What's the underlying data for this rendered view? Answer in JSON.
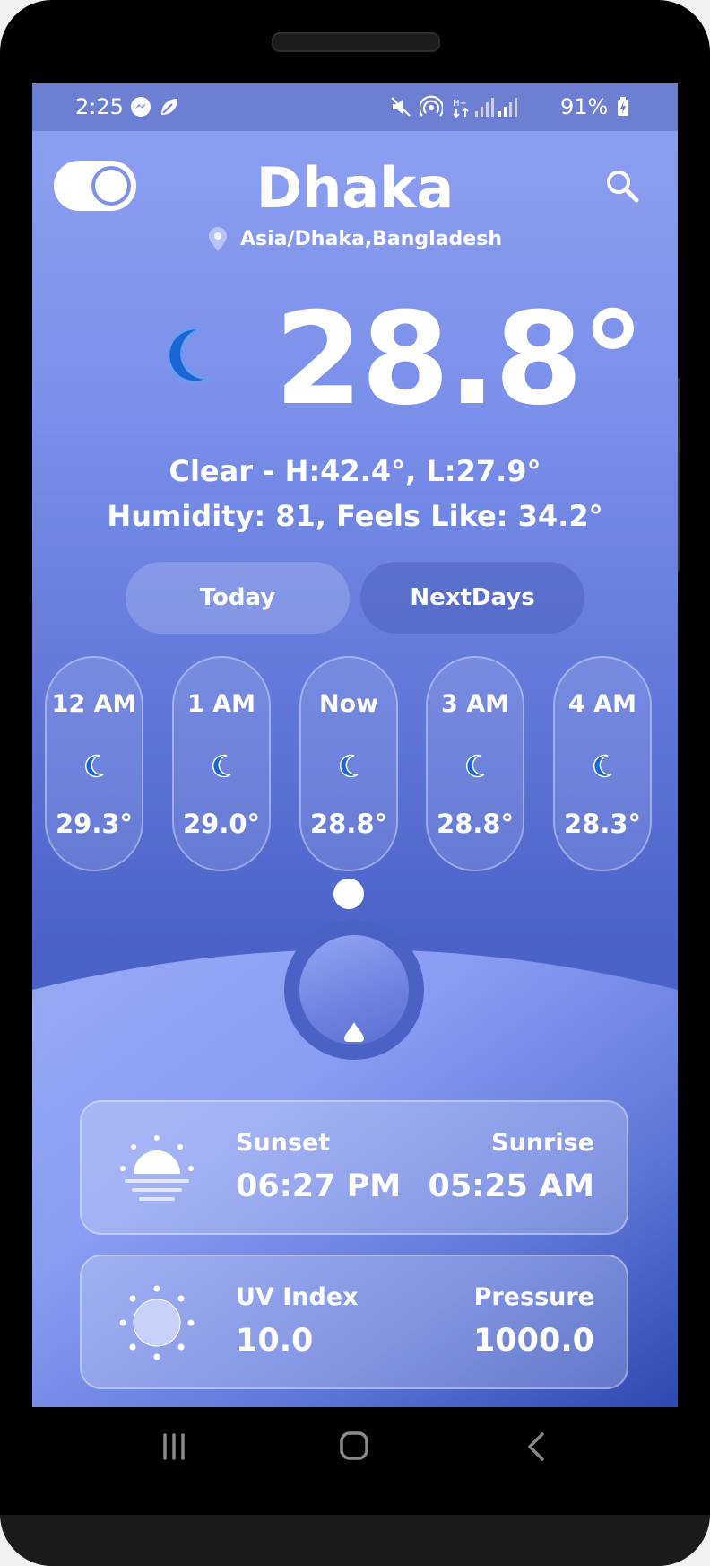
{
  "status_bar": {
    "time": "2:25",
    "battery": "91%"
  },
  "header": {
    "city": "Dhaka",
    "location": "Asia/Dhaka,Bangladesh",
    "theme_toggle_on": true
  },
  "current": {
    "temperature": "28.8°",
    "condition_line": "Clear - H:42.4°, L:27.9°",
    "details_line": "Humidity: 81, Feels Like: 34.2°"
  },
  "tabs": [
    {
      "label": "Today"
    },
    {
      "label": "NextDays"
    }
  ],
  "hourly": [
    {
      "label": "12 AM",
      "temp": "29.3°",
      "icon": "moon-icon"
    },
    {
      "label": "1 AM",
      "temp": "29.0°",
      "icon": "moon-icon"
    },
    {
      "label": "Now",
      "temp": "28.8°",
      "icon": "moon-icon"
    },
    {
      "label": "3 AM",
      "temp": "28.8°",
      "icon": "moon-icon"
    },
    {
      "label": "4 AM",
      "temp": "28.3°",
      "icon": "moon-icon"
    }
  ],
  "cards": {
    "sun": {
      "left_label": "Sunset",
      "left_value": "06:27 PM",
      "right_label": "Sunrise",
      "right_value": "05:25 AM",
      "icon": "sunset-icon"
    },
    "uv": {
      "left_label": "UV Index",
      "left_value": "10.0",
      "right_label": "Pressure",
      "right_value": "1000.0",
      "icon": "sun-icon"
    }
  },
  "colors": {
    "accent": "#7a8fe9",
    "moon": "#1a66d6"
  }
}
